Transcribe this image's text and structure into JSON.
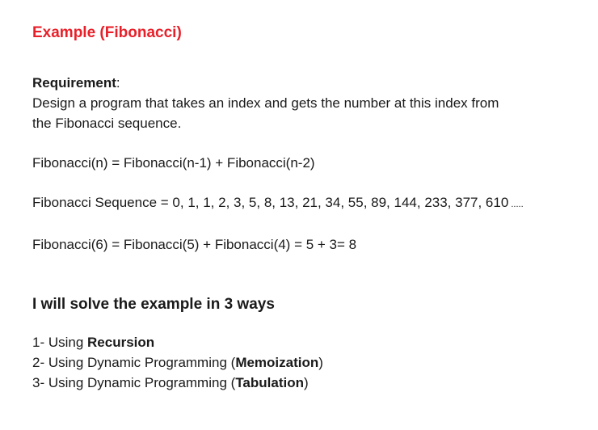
{
  "title": "Example (Fibonacci)",
  "requirement": {
    "label": "Requirement",
    "colon": ":",
    "line1": "Design a program that takes an index and gets the number at this  index from",
    "line2": "the Fibonacci sequence."
  },
  "formula": "Fibonacci(n) = Fibonacci(n-1) + Fibonacci(n-2)",
  "sequence": {
    "text": "Fibonacci Sequence = 0, 1, 1, 2, 3, 5, 8, 13, 21, 34, 55, 89, 144, 233, 377, 610",
    "tail": " ....."
  },
  "example_calc": "Fibonacci(6) = Fibonacci(5) + Fibonacci(4) = 5 + 3= 8",
  "subheading": "I will solve the example in 3 ways",
  "ways": [
    {
      "prefix": "1- Using ",
      "bold": "Recursion",
      "open": "",
      "close": ""
    },
    {
      "prefix": "2- Using Dynamic Programming ",
      "bold": "Memoization",
      "open": "(",
      "close": ")"
    },
    {
      "prefix": "3- Using Dynamic Programming ",
      "bold": "Tabulation",
      "open": "(",
      "close": ")"
    }
  ]
}
